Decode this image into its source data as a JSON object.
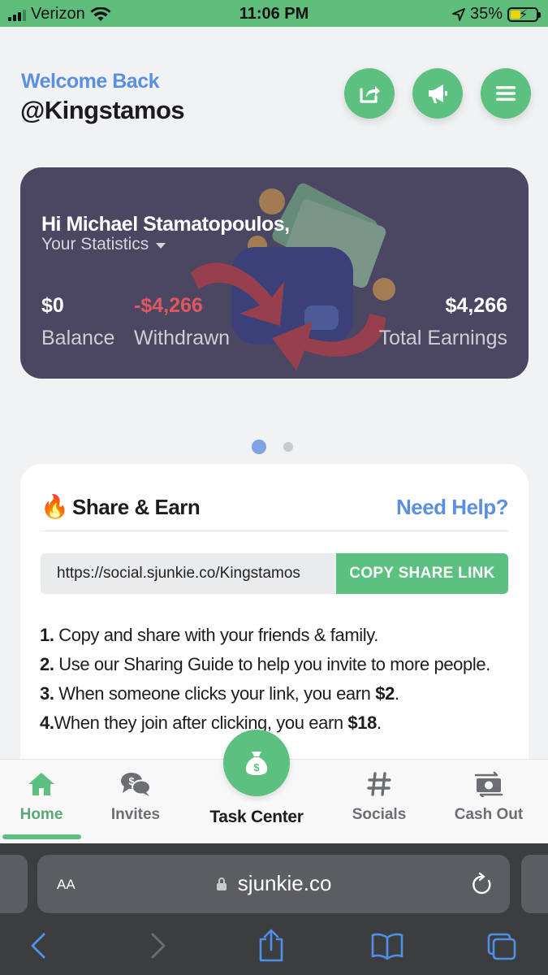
{
  "status_bar": {
    "carrier": "Verizon",
    "time": "11:06 PM",
    "battery": "35%"
  },
  "header": {
    "welcome": "Welcome Back",
    "username": "@Kingstamos",
    "buttons": [
      "share-icon",
      "megaphone-icon",
      "menu-icon"
    ]
  },
  "stats": {
    "greeting": "Hi Michael Stamatopoulos,",
    "subtitle": "Your Statistics",
    "balance_value": "$0",
    "balance_label": "Balance",
    "withdrawn_value": "-$4,266",
    "withdrawn_label": "Withdrawn",
    "total_value": "$4,266",
    "total_label": "Total Earnings",
    "withdrawn_color": "#e0575f"
  },
  "pager": {
    "active_index": 0,
    "count": 2
  },
  "share": {
    "icon": "🔥",
    "title": "Share & Earn",
    "help": "Need Help?",
    "link": "https://social.sjunkie.co/Kingstamos",
    "copy_button": "COPY SHARE LINK",
    "steps": [
      {
        "num": "1.",
        "text": " Copy and share with your friends & family.",
        "bold": ""
      },
      {
        "num": "2.",
        "text": " Use our Sharing Guide to help you invite to more people.",
        "bold": ""
      },
      {
        "num": "3.",
        "text": " When someone clicks your link, you earn ",
        "bold": "$2",
        "tail": "."
      },
      {
        "num": "4.",
        "text": "When they join after clicking, you earn ",
        "bold": "$18",
        "tail": "."
      }
    ]
  },
  "nav": {
    "home": "Home",
    "invites": "Invites",
    "task_center": "Task Center",
    "socials": "Socials",
    "cash_out": "Cash Out",
    "active": "Home",
    "accent": "#5cc080"
  },
  "browser": {
    "text_size": "AA",
    "url": "sjunkie.co"
  }
}
